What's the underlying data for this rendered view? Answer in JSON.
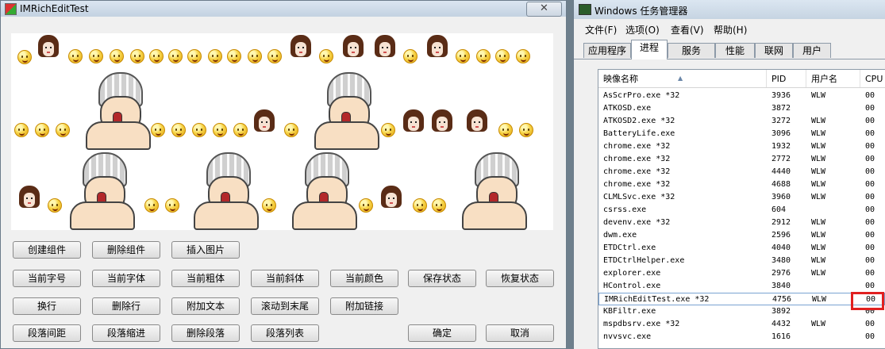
{
  "left_window": {
    "title": "IMRichEditTest",
    "close_label": "✕",
    "buttons_row1": [
      "创建组件",
      "删除组件",
      "插入图片"
    ],
    "buttons_row2": [
      "当前字号",
      "当前字体",
      "当前粗体",
      "当前斜体",
      "当前颜色",
      "保存状态",
      "恢复状态"
    ],
    "buttons_row3": [
      "换行",
      "删除行",
      "附加文本",
      "滚动到末尾",
      "附加链接"
    ],
    "buttons_row4": [
      "段落间距",
      "段落缩进",
      "删除段落",
      "段落列表"
    ],
    "ok_label": "确定",
    "cancel_label": "取消"
  },
  "task_manager": {
    "title": "Windows 任务管理器",
    "menu": [
      "文件(F)",
      "选项(O)",
      "查看(V)",
      "帮助(H)"
    ],
    "tabs": [
      "应用程序",
      "进程",
      "服务",
      "性能",
      "联网",
      "用户"
    ],
    "active_tab": "进程",
    "columns": [
      "映像名称",
      "PID",
      "用户名",
      "CPU"
    ],
    "rows": [
      {
        "name": "AsScrPro.exe *32",
        "pid": "3936",
        "user": "WLW",
        "cpu": "00"
      },
      {
        "name": "ATKOSD.exe",
        "pid": "3872",
        "user": "",
        "cpu": "00"
      },
      {
        "name": "ATKOSD2.exe *32",
        "pid": "3272",
        "user": "WLW",
        "cpu": "00"
      },
      {
        "name": "BatteryLife.exe",
        "pid": "3096",
        "user": "WLW",
        "cpu": "00"
      },
      {
        "name": "chrome.exe *32",
        "pid": "1932",
        "user": "WLW",
        "cpu": "00"
      },
      {
        "name": "chrome.exe *32",
        "pid": "2772",
        "user": "WLW",
        "cpu": "00"
      },
      {
        "name": "chrome.exe *32",
        "pid": "4440",
        "user": "WLW",
        "cpu": "00"
      },
      {
        "name": "chrome.exe *32",
        "pid": "4688",
        "user": "WLW",
        "cpu": "00"
      },
      {
        "name": "CLMLSvc.exe *32",
        "pid": "3960",
        "user": "WLW",
        "cpu": "00"
      },
      {
        "name": "csrss.exe",
        "pid": "604",
        "user": "",
        "cpu": "00"
      },
      {
        "name": "devenv.exe *32",
        "pid": "2912",
        "user": "WLW",
        "cpu": "00"
      },
      {
        "name": "dwm.exe",
        "pid": "2596",
        "user": "WLW",
        "cpu": "00"
      },
      {
        "name": "ETDCtrl.exe",
        "pid": "4040",
        "user": "WLW",
        "cpu": "00"
      },
      {
        "name": "ETDCtrlHelper.exe",
        "pid": "3480",
        "user": "WLW",
        "cpu": "00"
      },
      {
        "name": "explorer.exe",
        "pid": "2976",
        "user": "WLW",
        "cpu": "00"
      },
      {
        "name": "HControl.exe",
        "pid": "3840",
        "user": "",
        "cpu": "00"
      },
      {
        "name": "IMRichEditTest.exe *32",
        "pid": "4756",
        "user": "WLW",
        "cpu": "00"
      },
      {
        "name": "KBFiltr.exe",
        "pid": "3892",
        "user": "",
        "cpu": "00"
      },
      {
        "name": "mspdbsrv.exe *32",
        "pid": "4432",
        "user": "WLW",
        "cpu": "00"
      },
      {
        "name": "nvvsvc.exe",
        "pid": "1616",
        "user": "",
        "cpu": "00"
      }
    ],
    "selected_row": 16
  }
}
